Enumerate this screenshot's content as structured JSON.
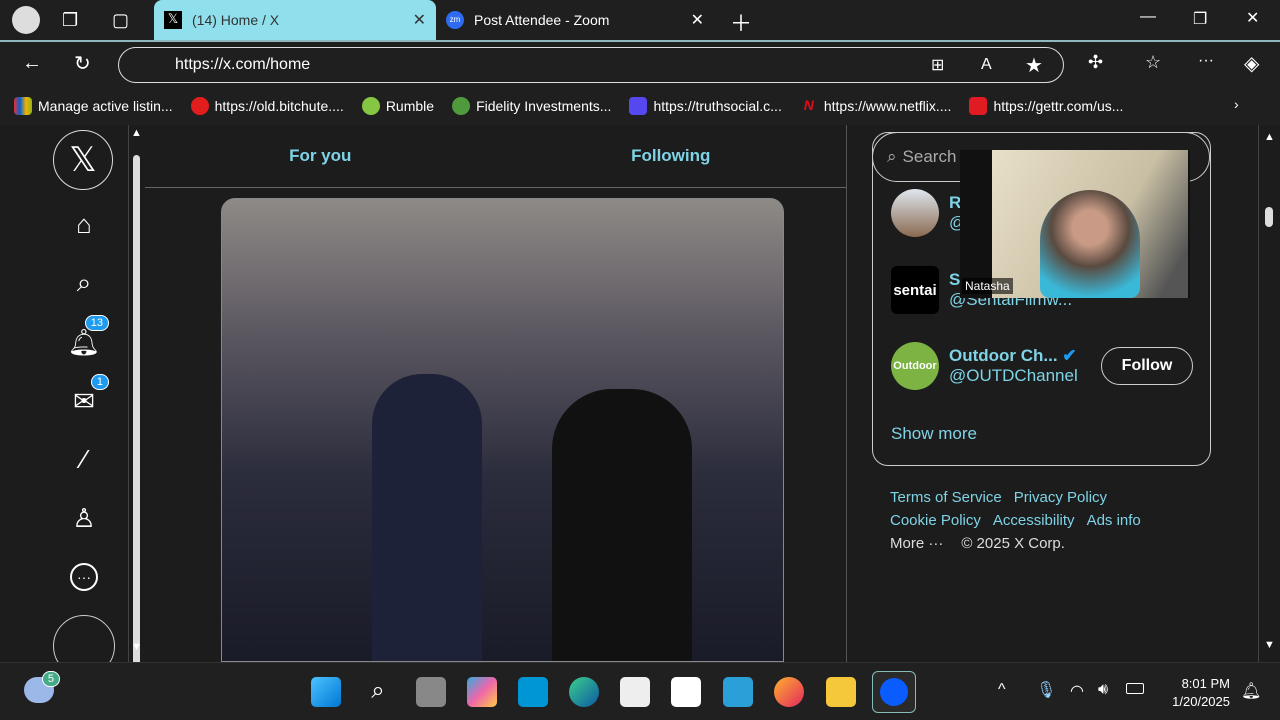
{
  "browser": {
    "tabs": [
      {
        "label": "(14) Home / X",
        "icon": "x-logo"
      },
      {
        "label": "Post Attendee - Zoom",
        "icon": "zoom-logo"
      }
    ],
    "url": "https://x.com/home",
    "bookmarks": [
      "Manage active listin...",
      "https://old.bitchute....",
      "Rumble",
      "Fidelity Investments...",
      "https://truthsocial.c...",
      "https://www.netflix....",
      "https://gettr.com/us..."
    ]
  },
  "nav": {
    "notifications_badge": "13",
    "messages_badge": "1"
  },
  "main": {
    "tabs": [
      "For you",
      "Following"
    ]
  },
  "right": {
    "search_placeholder": "Search",
    "accounts": [
      {
        "name": "R",
        "handle": "@"
      },
      {
        "name": "S",
        "handle": "@SentaiFilmw...",
        "avatar_text": "sentai"
      },
      {
        "name": "Outdoor Ch...",
        "handle": "@OUTDChannel",
        "avatar_text": "Outdoor",
        "verified": true,
        "button": "Follow"
      }
    ],
    "show_more": "Show more",
    "footer": [
      "Terms of Service",
      "Privacy Policy",
      "Cookie Policy",
      "Accessibility",
      "Ads info"
    ],
    "more": "More ···",
    "copyright": "© 2025 X Corp."
  },
  "zoom_overlay": {
    "participant": "Natasha"
  },
  "taskbar": {
    "weather_badge": "5",
    "time": "8:01 PM",
    "date": "1/20/2025"
  },
  "colors": {
    "accent": "#7fd3e6",
    "active_tab": "#8fe0ec",
    "verified": "#1d9bf0"
  }
}
